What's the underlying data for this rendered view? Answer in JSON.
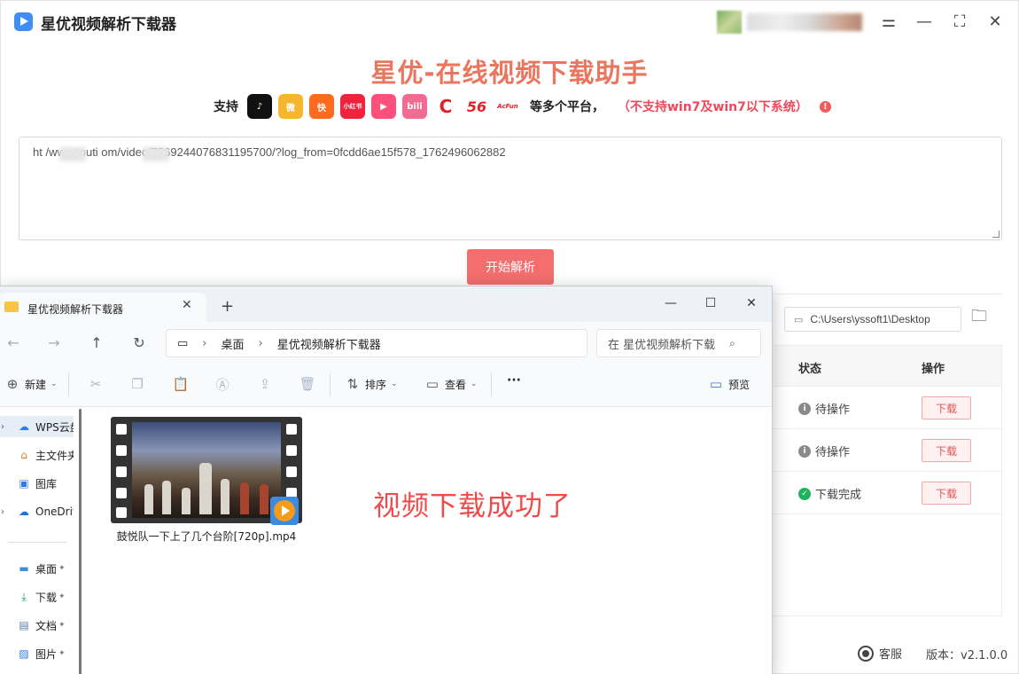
{
  "app": {
    "title": "星优视频解析下载器",
    "headline": "星优-在线视频下载助手",
    "support_label": "支持",
    "platforms": [
      {
        "name": "tiktok-icon",
        "glyph": "♪",
        "color": "#111111"
      },
      {
        "name": "weibo-icon",
        "glyph": "微",
        "color": "#f5b52e"
      },
      {
        "name": "kuaishou-icon",
        "glyph": "快",
        "color": "#ff6a1f"
      },
      {
        "name": "xiaohongshu-icon",
        "glyph": "小红书",
        "color": "#f1233c"
      },
      {
        "name": "xigua-icon",
        "glyph": "▶",
        "color": "#ff4f7a"
      },
      {
        "name": "bilibili-icon",
        "glyph": "bili",
        "color": "#f26b93"
      },
      {
        "name": "cctv-icon",
        "glyph": "C",
        "color": "#e21f26"
      },
      {
        "name": "56-icon",
        "glyph": "56",
        "color": "#ffffff"
      },
      {
        "name": "acfun-icon",
        "glyph": "AcFun",
        "color": "#ffffff"
      }
    ],
    "more_platforms": "等多个平台，",
    "compat_warning": "（不支持win7及win7以下系统）",
    "url_value": "ht      /www.touti      om/video/7569244076831195700/?log_from=0fcdd6ae15f578_1762496062882",
    "parse_button": "开始解析",
    "save_path": "C:\\Users\\yssoft1\\Desktop",
    "table_headers": {
      "status": "状态",
      "action": "操作"
    },
    "rows": [
      {
        "status": "待操作",
        "status_icon": "info-icon",
        "action": "下载"
      },
      {
        "status": "待操作",
        "status_icon": "info-icon",
        "action": "下载"
      },
      {
        "status": "下载完成",
        "status_icon": "check-icon",
        "action": "下载"
      }
    ],
    "support_link": "客服",
    "version": "版本：v2.1.0.0",
    "colors": {
      "accent": "#f36e6e",
      "headline": "#e9765e",
      "warning": "#f0475a",
      "done": "#1fb45c",
      "pending": "#8a8a8a"
    }
  },
  "explorer": {
    "tab_title": "星优视频解析下载器",
    "breadcrumb": [
      "桌面",
      "星优视频解析下载器"
    ],
    "search_placeholder": "在 星优视频解析下载",
    "toolbar": {
      "new": "新建",
      "sort": "排序",
      "view": "查看",
      "more": "···",
      "preview": "预览"
    },
    "sidebar": [
      {
        "label": "WPS云盘",
        "icon": "cloud-icon"
      },
      {
        "label": "主文件夹",
        "icon": "home-icon"
      },
      {
        "label": "图库",
        "icon": "gallery-icon"
      },
      {
        "label": "OneDrive",
        "icon": "onedrive-icon"
      },
      {
        "label": "桌面",
        "icon": "desktop-icon"
      },
      {
        "label": "下载",
        "icon": "download-icon"
      },
      {
        "label": "文档",
        "icon": "document-icon"
      },
      {
        "label": "图片",
        "icon": "picture-icon"
      }
    ],
    "file": {
      "name": "鼓悦队一下上了几个台阶[720p].mp4"
    }
  },
  "annotation": "视频下载成功了"
}
